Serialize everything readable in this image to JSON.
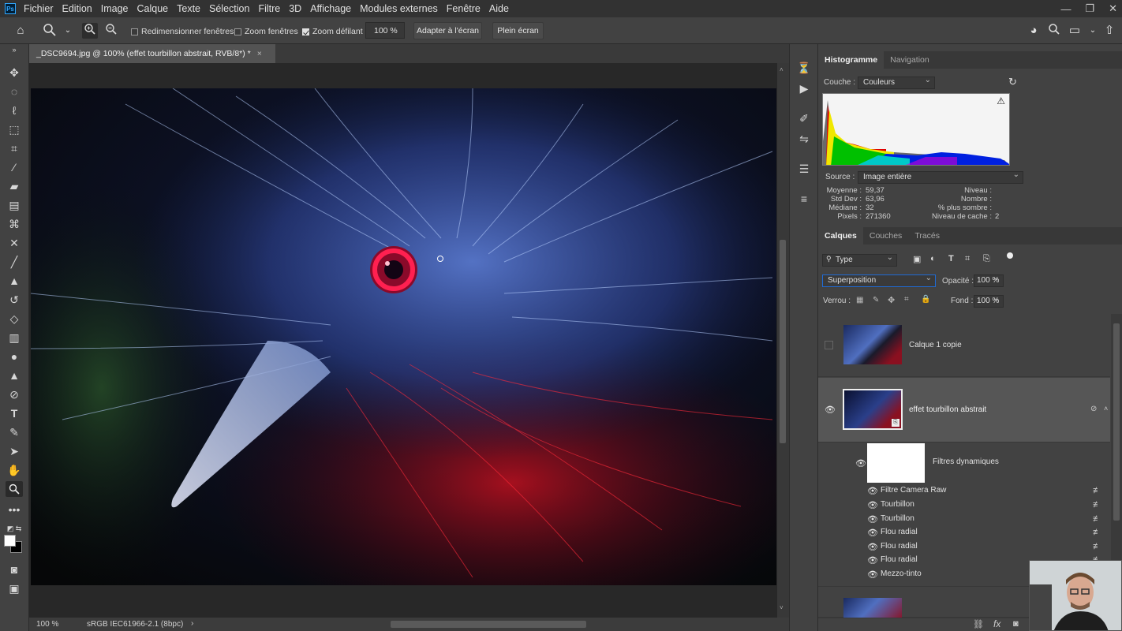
{
  "app": {
    "logo": "Ps"
  },
  "menu": [
    "Fichier",
    "Edition",
    "Image",
    "Calque",
    "Texte",
    "Sélection",
    "Filtre",
    "3D",
    "Affichage",
    "Modules externes",
    "Fenêtre",
    "Aide"
  ],
  "window_controls": {
    "minimize": "—",
    "maximize": "❐",
    "close": "✕"
  },
  "options_bar": {
    "resize_windows_label": "Redimensionner fenêtres",
    "resize_windows_checked": false,
    "zoom_windows_label": "Zoom fenêtres",
    "zoom_windows_checked": false,
    "scrubby_zoom_label": "Zoom défilant",
    "scrubby_zoom_checked": true,
    "zoom_value": "100 %",
    "fit_screen_label": "Adapter à l'écran",
    "fill_screen_label": "Plein écran"
  },
  "document": {
    "tab_title": "_DSC9694.jpg @ 100% (effet tourbillon abstrait, RVB/8*) *",
    "close_glyph": "×"
  },
  "status_bar": {
    "zoom": "100 %",
    "profile": "sRGB IEC61966-2.1 (8bpc)",
    "arrow": "›"
  },
  "histogram_panel": {
    "tabs": [
      "Histogramme",
      "Navigation"
    ],
    "channel_label": "Couche :",
    "channel_value": "Couleurs",
    "source_label": "Source :",
    "source_value": "Image entière",
    "warning": "⚠",
    "stats_left": [
      {
        "label": "Moyenne :",
        "value": "59,37"
      },
      {
        "label": "Std Dev :",
        "value": "63,96"
      },
      {
        "label": "Médiane :",
        "value": "32"
      },
      {
        "label": "Pixels :",
        "value": "271360"
      }
    ],
    "stats_right": [
      {
        "label": "Niveau :",
        "value": ""
      },
      {
        "label": "Nombre :",
        "value": ""
      },
      {
        "label": "% plus sombre :",
        "value": ""
      },
      {
        "label": "Niveau de cache :",
        "value": "2"
      }
    ]
  },
  "layers_panel": {
    "tabs": [
      "Calques",
      "Couches",
      "Tracés"
    ],
    "filter_kind": "Type",
    "blend_mode": "Superposition",
    "opacity_label": "Opacité :",
    "opacity_value": "100 %",
    "lock_label": "Verrou :",
    "fill_label": "Fond :",
    "fill_value": "100 %",
    "layers": [
      {
        "name": "Calque 1 copie",
        "visible": false,
        "selected": false
      },
      {
        "name": "effet tourbillon abstrait",
        "visible": true,
        "selected": true
      }
    ],
    "smart_filters_label": "Filtres dynamiques",
    "smart_filters": [
      "Filtre Camera Raw",
      "Tourbillon",
      "Tourbillon",
      "Flou radial",
      "Flou radial",
      "Flou radial",
      "Mezzo-tinto"
    ],
    "footer_icons": [
      "link-icon",
      "fx-icon",
      "mask-icon"
    ]
  },
  "colors": {
    "menubar": "#323232",
    "panel": "#424242",
    "canvas_bg": "#282828",
    "selected_row": "#565656"
  }
}
